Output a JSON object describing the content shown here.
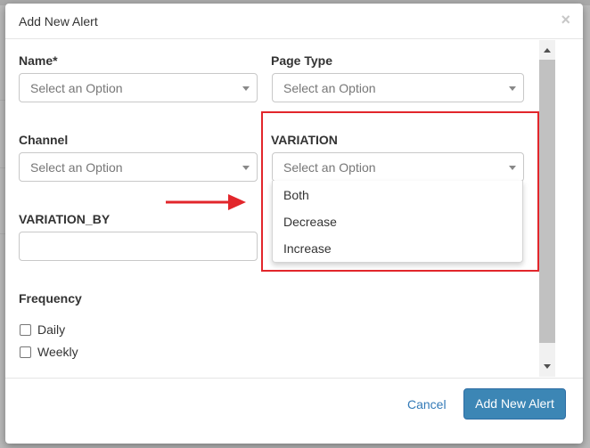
{
  "modal": {
    "title": "Add New Alert",
    "close_glyph": "×"
  },
  "form": {
    "name": {
      "label": "Name*",
      "placeholder": "Select an Option"
    },
    "page_type": {
      "label": "Page Type",
      "placeholder": "Select an Option"
    },
    "channel": {
      "label": "Channel",
      "placeholder": "Select an Option"
    },
    "variation": {
      "label": "VARIATION",
      "placeholder": "Select an Option",
      "options": [
        "Both",
        "Decrease",
        "Increase"
      ]
    },
    "variation_by": {
      "label": "VARIATION_BY",
      "value": ""
    },
    "frequency": {
      "label": "Frequency",
      "options": [
        {
          "label": "Daily",
          "checked": false
        },
        {
          "label": "Weekly",
          "checked": false
        }
      ]
    }
  },
  "footer": {
    "cancel_label": "Cancel",
    "submit_label": "Add New Alert"
  },
  "annotation": {
    "color": "#e2262b"
  },
  "colors": {
    "primary": "#3c86b5",
    "link": "#337ab7"
  }
}
